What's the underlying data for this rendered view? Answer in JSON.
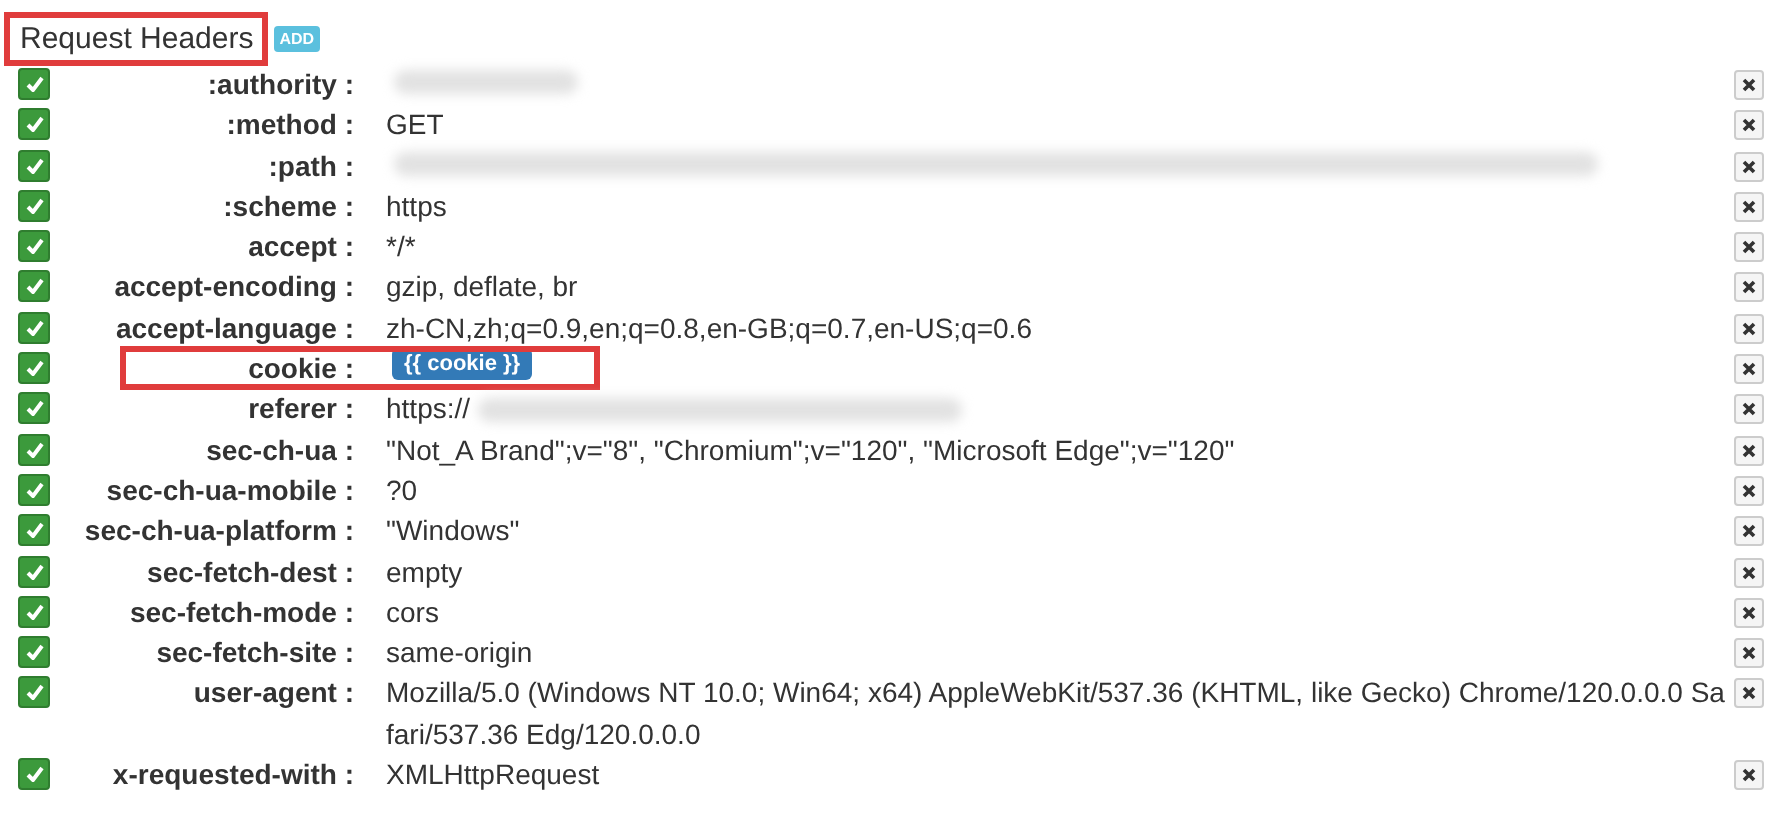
{
  "section": {
    "title": "Request Headers",
    "highlighted": true,
    "add_button": "ADD"
  },
  "headers": [
    {
      "name": ":authority :",
      "enabled": true,
      "kind": "redacted",
      "highlighted": false
    },
    {
      "name": ":method :",
      "enabled": true,
      "kind": "text",
      "value": "GET",
      "highlighted": false
    },
    {
      "name": ":path :",
      "enabled": true,
      "kind": "redacted",
      "highlighted": false
    },
    {
      "name": ":scheme :",
      "enabled": true,
      "kind": "text",
      "value": "https",
      "highlighted": false
    },
    {
      "name": "accept :",
      "enabled": true,
      "kind": "text",
      "value": "*/*",
      "highlighted": false
    },
    {
      "name": "accept-encoding :",
      "enabled": true,
      "kind": "text",
      "value": "gzip, deflate, br",
      "highlighted": false
    },
    {
      "name": "accept-language :",
      "enabled": true,
      "kind": "text",
      "value": "zh-CN,zh;q=0.9,en;q=0.8,en-GB;q=0.7,en-US;q=0.6",
      "highlighted": false
    },
    {
      "name": "cookie :",
      "enabled": true,
      "kind": "variable",
      "value": "{{ cookie }}",
      "highlighted": true
    },
    {
      "name": "referer :",
      "enabled": true,
      "kind": "partly-redacted",
      "value": "https://",
      "highlighted": false
    },
    {
      "name": "sec-ch-ua :",
      "enabled": true,
      "kind": "text",
      "value": "\"Not_A Brand\";v=\"8\", \"Chromium\";v=\"120\", \"Microsoft Edge\";v=\"120\"",
      "highlighted": false
    },
    {
      "name": "sec-ch-ua-mobile :",
      "enabled": true,
      "kind": "text",
      "value": "?0",
      "highlighted": false
    },
    {
      "name": "sec-ch-ua-platform :",
      "enabled": true,
      "kind": "text",
      "value": "\"Windows\"",
      "highlighted": false
    },
    {
      "name": "sec-fetch-dest :",
      "enabled": true,
      "kind": "text",
      "value": "empty",
      "highlighted": false
    },
    {
      "name": "sec-fetch-mode :",
      "enabled": true,
      "kind": "text",
      "value": "cors",
      "highlighted": false
    },
    {
      "name": "sec-fetch-site :",
      "enabled": true,
      "kind": "text",
      "value": "same-origin",
      "highlighted": false
    },
    {
      "name": "user-agent :",
      "enabled": true,
      "kind": "text",
      "value": "Mozilla/5.0 (Windows NT 10.0; Win64; x64) AppleWebKit/537.36 (KHTML, like Gecko) Chrome/120.0.0.0 Safari/537.36 Edg/120.0.0.0",
      "highlighted": false
    },
    {
      "name": "x-requested-with :",
      "enabled": true,
      "kind": "text",
      "value": "XMLHttpRequest",
      "highlighted": false
    }
  ]
}
